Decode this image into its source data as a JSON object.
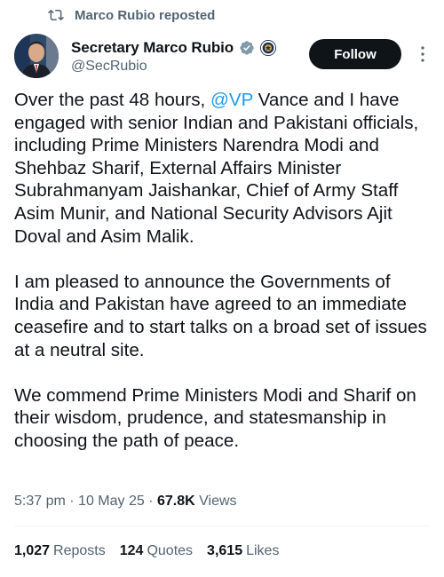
{
  "repost": {
    "text": "Marco Rubio reposted",
    "icon": "repost-icon"
  },
  "author": {
    "name": "Secretary Marco Rubio",
    "handle": "@SecRubio",
    "verified_color": "#829aab",
    "badge_icon": "state-department-seal-icon"
  },
  "follow_label": "Follow",
  "tweet": {
    "p1_before": "Over the past 48 hours, ",
    "p1_mention": "@VP",
    "p1_after": " Vance and I have engaged with senior Indian and Pakistani officials, including Prime Ministers Narendra Modi and Shehbaz Sharif, External Affairs Minister Subrahmanyam Jaishankar, Chief of Army Staff Asim Munir, and National Security Advisors Ajit Doval and Asim Malik.",
    "p2": "I am pleased to announce the Governments of India and Pakistan have agreed to an immediate ceasefire and to start talks on a broad set of issues at a neutral site.",
    "p3": "We commend Prime Ministers Modi and Sharif on their wisdom, prudence, and statesmanship in choosing the path of peace."
  },
  "meta": {
    "time": "5:37 pm",
    "date": "10 May 25",
    "views_count": "67.8K",
    "views_label": "Views"
  },
  "stats": {
    "reposts_count": "1,027",
    "reposts_label": "Reposts",
    "quotes_count": "124",
    "quotes_label": "Quotes",
    "likes_count": "3,615",
    "likes_label": "Likes"
  },
  "colors": {
    "accent": "#1d9bf0",
    "muted": "#536471",
    "text": "#0f1419"
  }
}
